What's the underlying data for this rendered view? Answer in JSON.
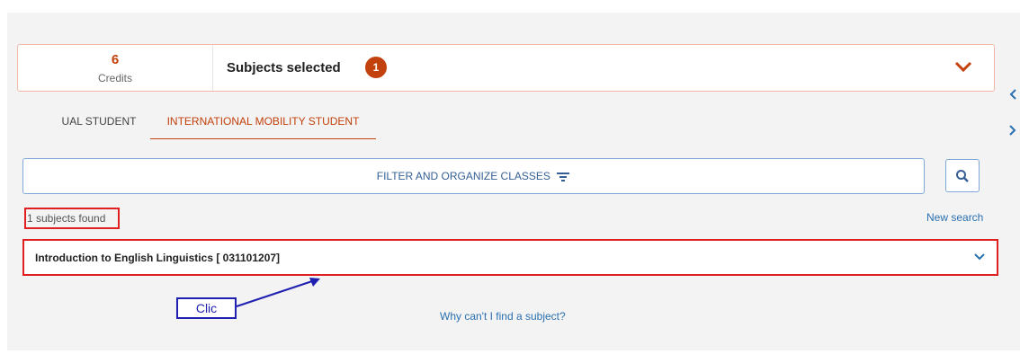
{
  "summary": {
    "credits_value": "6",
    "credits_label": "Credits",
    "title": "Subjects selected",
    "selected_count": "1"
  },
  "tabs": [
    {
      "label": "UAL STUDENT",
      "active": false
    },
    {
      "label": "INTERNATIONAL MOBILITY STUDENT",
      "active": true
    }
  ],
  "filter": {
    "label": "FILTER AND ORGANIZE CLASSES"
  },
  "results": {
    "count_text": "1 subjects found",
    "new_search_label": "New search",
    "items": [
      {
        "title": "Introduction to English Linguistics [ 031101207]"
      }
    ]
  },
  "annotation": {
    "label": "Clic"
  },
  "help_link": "Why can't I find a subject?",
  "colors": {
    "accent": "#c2410c",
    "link": "#2a6fb0",
    "highlight": "#e02020",
    "annotation": "#1f1fb0"
  },
  "icons": [
    "chevron-left-icon",
    "chevron-right-icon",
    "chevron-down-icon",
    "filter-icon",
    "search-icon"
  ]
}
